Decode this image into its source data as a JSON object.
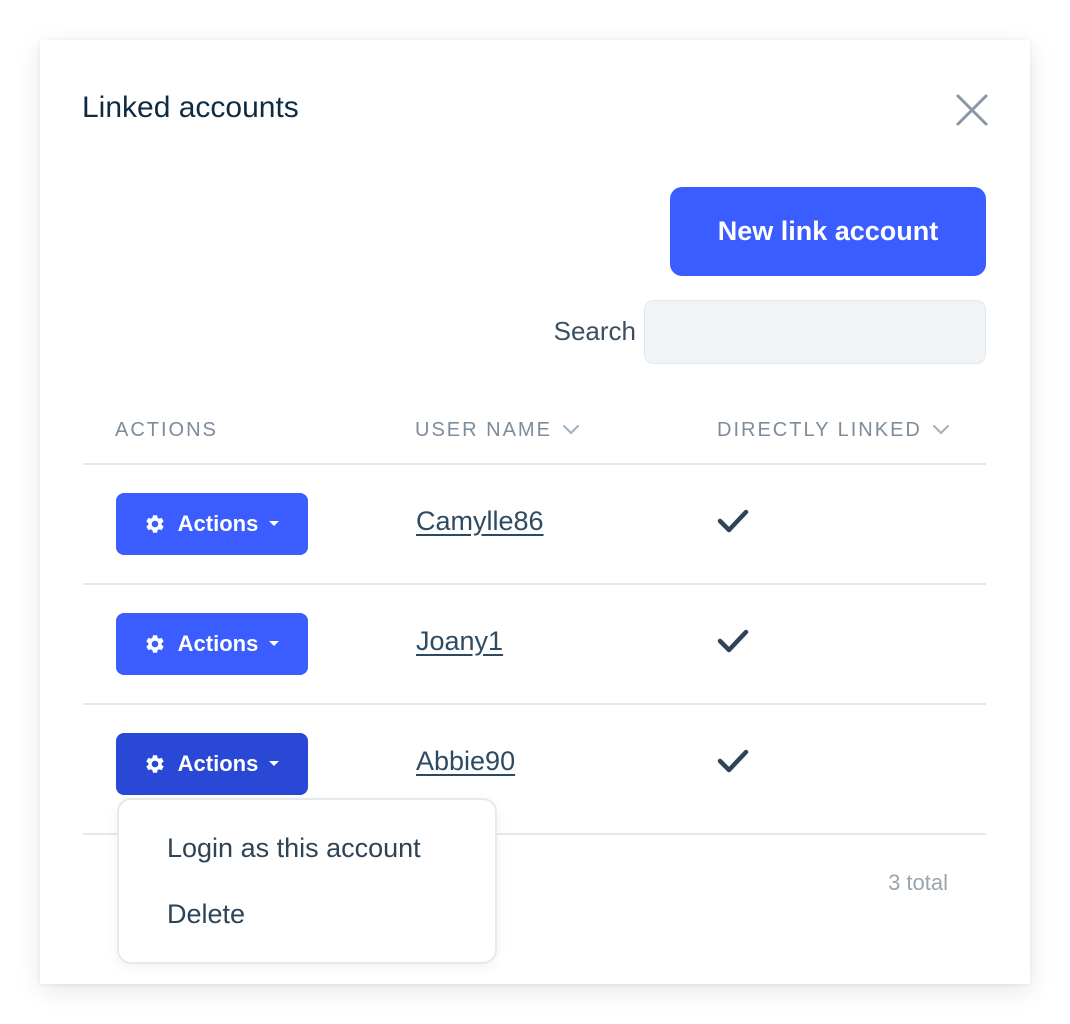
{
  "modal": {
    "title": "Linked accounts",
    "close_icon": "close-icon"
  },
  "toolbar": {
    "new_link_label": "New link account",
    "search_label": "Search",
    "search_value": ""
  },
  "table": {
    "headers": {
      "actions": "ACTIONS",
      "user_name": "USER NAME",
      "directly_linked": "DIRECTLY LINKED"
    },
    "rows": [
      {
        "actions_label": "Actions",
        "user_name": "Camylle86",
        "directly_linked": true
      },
      {
        "actions_label": "Actions",
        "user_name": "Joany1",
        "directly_linked": true
      },
      {
        "actions_label": "Actions",
        "user_name": "Abbie90",
        "directly_linked": true
      }
    ],
    "total": "3 total"
  },
  "dropdown": {
    "open_for_row": 3,
    "items": [
      "Login as this account",
      "Delete"
    ]
  },
  "colors": {
    "primary": "#3b5cff",
    "primary_active": "#2a48d6",
    "title": "#0d2b42",
    "text": "#2e4a63",
    "muted": "#7d8c9b"
  },
  "icons": {
    "gear": "gear-icon",
    "caret": "caret-down-icon",
    "sort": "chevron-down-icon",
    "check": "check-icon"
  }
}
